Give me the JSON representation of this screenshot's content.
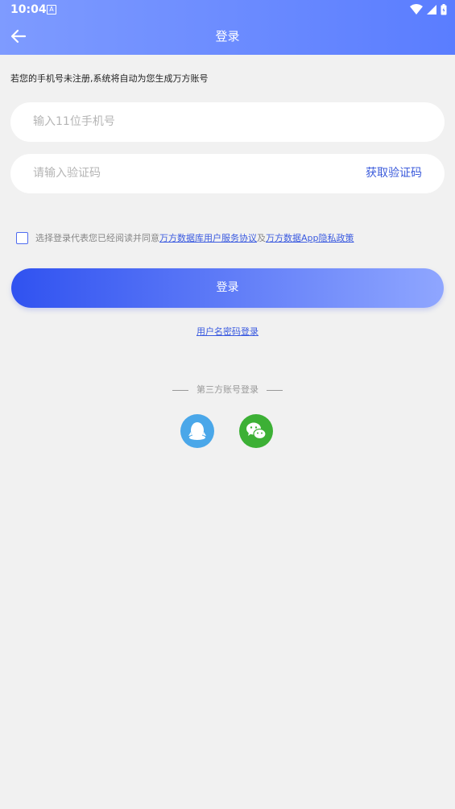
{
  "status_bar": {
    "time": "10:04",
    "notification_icon": "A"
  },
  "header": {
    "title": "登录"
  },
  "notice": "若您的手机号未注册,系统将自动为您生成万方账号",
  "phone_field": {
    "placeholder": "输入11位手机号"
  },
  "code_field": {
    "placeholder": "请输入验证码",
    "get_code_label": "获取验证码"
  },
  "agreement": {
    "prefix": "选择登录代表您已经阅读并同意",
    "link1": "万方数据库用户服务协议",
    "middle": "及",
    "link2": "万方数据App隐私政策"
  },
  "login_button": "登录",
  "password_login": "用户名密码登录",
  "third_party": {
    "label": "第三方账号登录",
    "icons": [
      "qq-icon",
      "wechat-icon"
    ]
  },
  "colors": {
    "accent": "#3b5bdb",
    "header_start": "#7e9bff",
    "header_end": "#5a7dff",
    "qq": "#4aa7e9",
    "wechat": "#3cb035"
  }
}
